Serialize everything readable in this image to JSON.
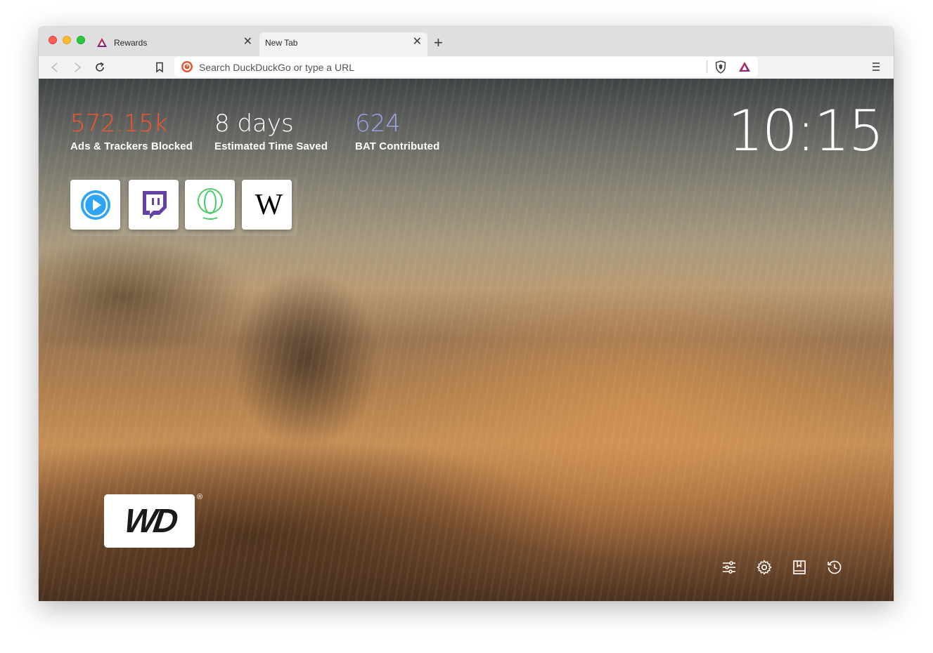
{
  "tabs": [
    {
      "title": "Rewards",
      "active": false
    },
    {
      "title": "New Tab",
      "active": true
    }
  ],
  "toolbar": {
    "url_placeholder": "Search DuckDuckGo or type a URL"
  },
  "stats": [
    {
      "value": "572.15k",
      "label": "Ads & Trackers Blocked",
      "color": "#fb542b"
    },
    {
      "value": "8 days",
      "label": "Estimated Time Saved",
      "color": "#ffffff"
    },
    {
      "value": "624",
      "label": "BAT Contributed",
      "color": "#a0a5eb"
    }
  ],
  "clock": "10:15",
  "top_sites": [
    {
      "icon": "play-circle-icon",
      "color": "#2da5f3"
    },
    {
      "icon": "twitch-icon",
      "color": "#6441a4"
    },
    {
      "icon": "uphold-icon",
      "color": "#49cc68"
    },
    {
      "icon": "wikipedia-icon",
      "color": "#000000"
    }
  ],
  "sponsor_logo": {
    "text": "WD",
    "mark": "®"
  },
  "bottom_actions": [
    "customize-icon",
    "settings-icon",
    "bookmarks-icon",
    "history-icon"
  ],
  "colors": {
    "brave_orange": "#fb542b",
    "bat_purple": "#a0a5eb"
  }
}
